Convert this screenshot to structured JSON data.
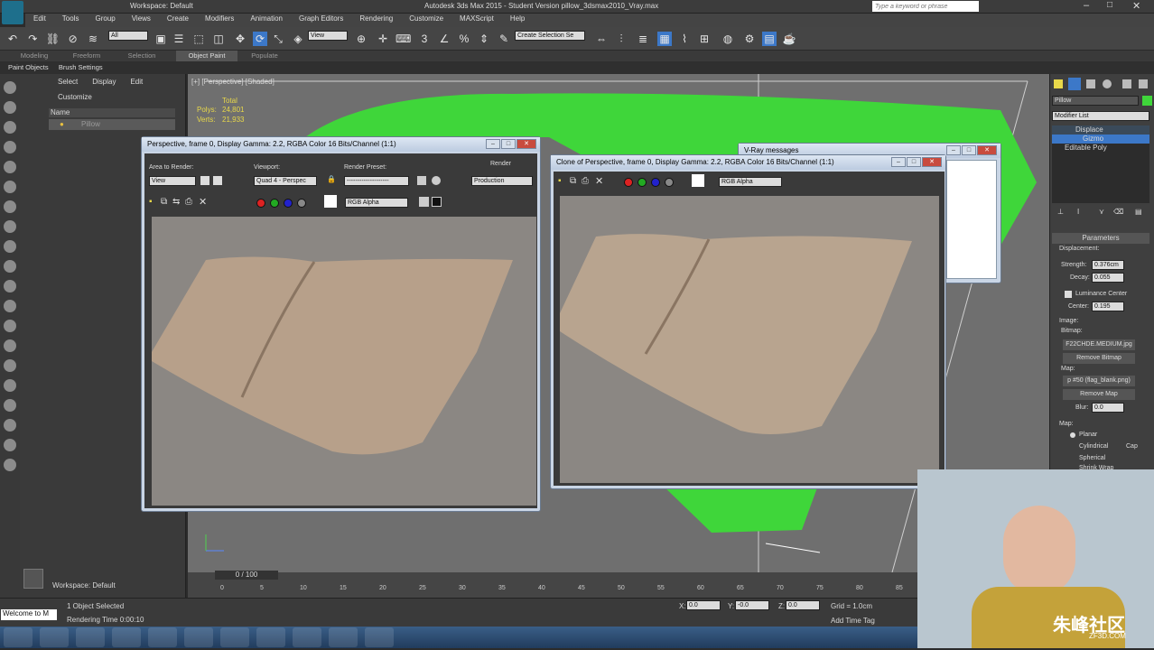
{
  "app": {
    "workspace": "Workspace: Default",
    "title": "Autodesk 3ds Max 2015 - Student Version   pillow_3dsmax2010_Vray.max",
    "search_placeholder": "Type a keyword or phrase"
  },
  "menu": [
    "Edit",
    "Tools",
    "Group",
    "Views",
    "Create",
    "Modifiers",
    "Animation",
    "Graph Editors",
    "Rendering",
    "Customize",
    "MAXScript",
    "Help"
  ],
  "toolbar": {
    "filter": "All",
    "refcoord": "View",
    "selset": "Create Selection Se"
  },
  "ribbon": {
    "tabs": [
      "Modeling",
      "Freeform",
      "Selection",
      "Object Paint",
      "Populate"
    ],
    "sub": [
      "Paint Objects",
      "Brush Settings"
    ]
  },
  "scene": {
    "tabs": [
      "Select",
      "Display",
      "Edit",
      "Customize"
    ],
    "col_header": "Name",
    "item": "Pillow",
    "workspace": "Workspace: Default"
  },
  "viewport": {
    "label": "[+] [Perspective] [Shaded]",
    "total": "Total",
    "polys_label": "Polys:",
    "polys": "24,801",
    "verts_label": "Verts:",
    "verts": "21,933"
  },
  "render1": {
    "title": "Perspective, frame 0, Display Gamma: 2.2, RGBA Color 16 Bits/Channel (1:1)",
    "area_label": "Area to Render:",
    "area": "View",
    "viewport_label": "Viewport:",
    "viewport": "Quad 4 - Perspec",
    "preset_label": "Render Preset:",
    "preset": "--------------------",
    "render_label": "Render",
    "mode": "Production",
    "channel": "RGB Alpha"
  },
  "render2": {
    "title": "Clone of Perspective, frame 0, Display Gamma: 2.2, RGBA Color 16 Bits/Channel (1:1)",
    "channel": "RGB Alpha"
  },
  "vray": {
    "title": "V-Ray messages"
  },
  "rightpanel": {
    "name": "Pillow",
    "modlist": "Modifier List",
    "stack": [
      "Displace",
      "Gizmo",
      "Editable Poly"
    ],
    "rollout": "Parameters",
    "displacement": "Displacement:",
    "strength_label": "Strength:",
    "strength": "0.376cm",
    "decay_label": "Decay:",
    "decay": "0.055",
    "lum": "Luminance Center",
    "center_label": "Center:",
    "center": "0.195",
    "image": "Image:",
    "bitmap_label": "Bitmap:",
    "bitmap": "F22CHDE.MEDIUM.jpg",
    "remove_bitmap": "Remove Bitmap",
    "map_label": "Map:",
    "map": "p #50 (flag_blank.png)",
    "remove_map": "Remove Map",
    "blur_label": "Blur:",
    "blur": "0.0",
    "map2": "Map:",
    "planar": "Planar",
    "cyl": "Cylindrical",
    "cap": "Cap",
    "sph": "Spherical",
    "shrink": "Shrink Wrap"
  },
  "timeline": {
    "frame": "0 / 100",
    "ticks": [
      "0",
      "5",
      "10",
      "15",
      "20",
      "25",
      "30",
      "35",
      "40",
      "45",
      "50",
      "55",
      "60",
      "65",
      "70",
      "75",
      "80",
      "85"
    ]
  },
  "status": {
    "welcome": "Welcome to M",
    "selected": "1 Object Selected",
    "rendertime": "Rendering Time  0:00:10",
    "x_label": "X:",
    "x": "0.0",
    "y_label": "Y:",
    "y": "-0.0",
    "z_label": "Z:",
    "z": "0.0",
    "grid": "Grid = 1.0cm",
    "addtime": "Add Time Tag"
  },
  "watermark": "朱峰社区",
  "watermark2": "ZF3D.COM"
}
